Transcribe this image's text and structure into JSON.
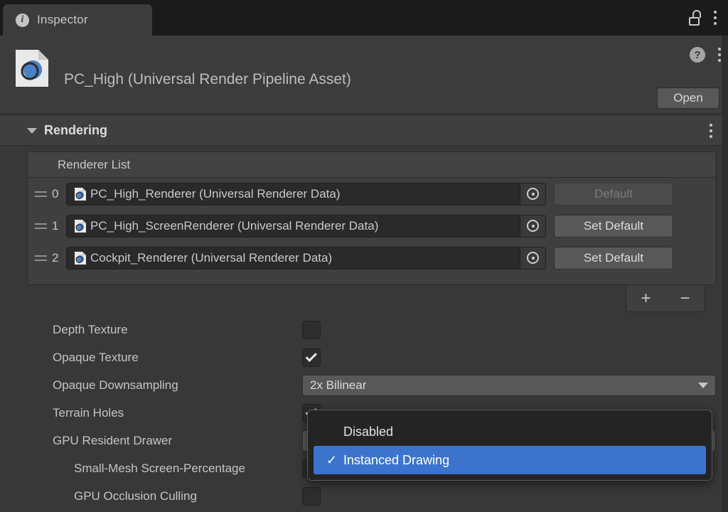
{
  "window": {
    "tab_label": "Inspector",
    "tab_icon": "info-icon",
    "lock_icon": "unlocked-padlock-icon",
    "menu_icon": "kebab-menu-icon"
  },
  "asset_header": {
    "title": "PC_High (Universal Render Pipeline Asset)",
    "icon": "urp-asset-icon",
    "help_label": "?",
    "menu_icon": "kebab-menu-icon",
    "open_button": "Open"
  },
  "section": {
    "title": "Rendering",
    "expanded": true,
    "foldout_icon": "triangle-down-icon",
    "menu_icon": "kebab-menu-icon"
  },
  "renderer_list": {
    "header": "Renderer List",
    "rows": [
      {
        "index": "0",
        "name": "PC_High_Renderer (Universal Renderer Data)",
        "button": "Default",
        "button_disabled": true
      },
      {
        "index": "1",
        "name": "PC_High_ScreenRenderer (Universal Renderer Data)",
        "button": "Set Default",
        "button_disabled": false
      },
      {
        "index": "2",
        "name": "Cockpit_Renderer (Universal Renderer Data)",
        "button": "Set Default",
        "button_disabled": false
      }
    ],
    "add_label": "+",
    "remove_label": "−"
  },
  "properties": [
    {
      "label": "Depth Texture",
      "type": "checkbox",
      "value": false
    },
    {
      "label": "Opaque Texture",
      "type": "checkbox",
      "value": true
    },
    {
      "label": "Opaque Downsampling",
      "type": "popup",
      "value": "2x Bilinear"
    },
    {
      "label": "Terrain Holes",
      "type": "checkbox",
      "value": true
    },
    {
      "label": "GPU Resident Drawer",
      "type": "popup",
      "value": "Instanced Drawing"
    },
    {
      "label": "Small-Mesh Screen-Percentage",
      "type": "field",
      "value": "",
      "indent": true
    },
    {
      "label": "GPU Occlusion Culling",
      "type": "checkbox",
      "value": false,
      "indent": true
    }
  ],
  "dropdown": {
    "open": true,
    "items": [
      {
        "label": "Disabled",
        "selected": false,
        "check": ""
      },
      {
        "label": "Instanced Drawing",
        "selected": true,
        "check": "✓"
      }
    ]
  },
  "colors": {
    "background": "#383838",
    "panel": "#3c3c3c",
    "tabbar": "#1b1b1b",
    "accent_selection": "#3c74cd",
    "text": "#c4c4c4",
    "text_disabled": "#7b7b7b"
  }
}
